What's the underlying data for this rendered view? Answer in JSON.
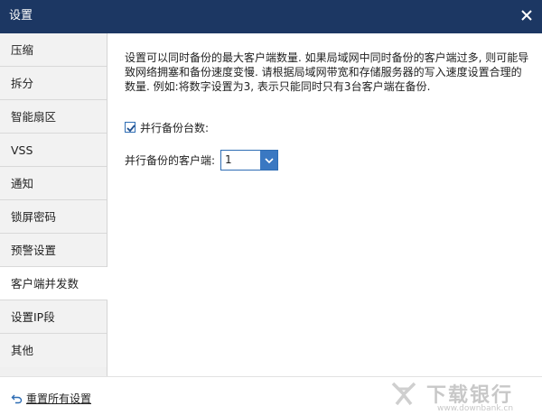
{
  "window": {
    "title": "设置"
  },
  "sidebar": {
    "items": [
      {
        "label": "压缩"
      },
      {
        "label": "拆分"
      },
      {
        "label": "智能扇区"
      },
      {
        "label": "VSS"
      },
      {
        "label": "通知"
      },
      {
        "label": "锁屏密码"
      },
      {
        "label": "预警设置"
      },
      {
        "label": "客户端并发数",
        "active": true
      },
      {
        "label": "设置IP段"
      },
      {
        "label": "其他"
      }
    ]
  },
  "main": {
    "description": "设置可以同时备份的最大客户端数量. 如果局域网中同时备份的客户端过多, 则可能导致网络拥塞和备份速度变慢. 请根据局域网带宽和存储服务器的写入速度设置合理的数量. 例如:将数字设置为3, 表示只能同时只有3台客户端在备份.",
    "parallel_checkbox": {
      "label": "并行备份台数:",
      "checked": true
    },
    "client_select": {
      "label": "并行备份的客户端:",
      "value": "1"
    }
  },
  "footer": {
    "reset_label": "重置所有设置"
  },
  "watermark": {
    "title": "下载银行",
    "url": "www.downbank.cn"
  },
  "colors": {
    "titlebar": "#1c3763",
    "accent": "#3a78c2"
  }
}
